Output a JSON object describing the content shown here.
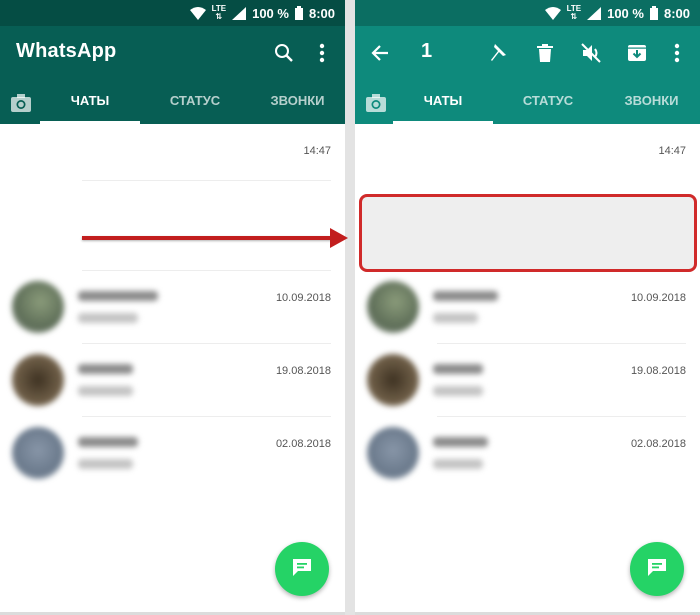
{
  "status_bar": {
    "battery": "100 %",
    "time": "8:00",
    "network": "LTE"
  },
  "left_phone": {
    "app_title": "WhatsApp",
    "tabs": [
      "ЧАТЫ",
      "СТАТУС",
      "ЗВОНКИ"
    ],
    "chats": [
      {
        "time": "14:47"
      },
      {
        "time": "10.09.2018"
      },
      {
        "time": "19.08.2018"
      },
      {
        "time": "02.08.2018"
      }
    ]
  },
  "right_phone": {
    "selected_count": "1",
    "tabs": [
      "ЧАТЫ",
      "СТАТУС",
      "ЗВОНКИ"
    ],
    "chats": [
      {
        "time": "14:47"
      },
      {
        "time": "10.09.2018"
      },
      {
        "time": "19.08.2018"
      },
      {
        "time": "02.08.2018"
      }
    ]
  },
  "icons": {
    "left_toolbar": [
      "search-icon",
      "more-vert-icon"
    ],
    "right_toolbar": [
      "back-arrow-icon",
      "pin-icon",
      "delete-icon",
      "mute-icon",
      "archive-icon",
      "more-vert-icon"
    ],
    "fab": "new-chat-icon",
    "camera_tab": "camera-icon"
  },
  "colors": {
    "header_dark": "#075e54",
    "header_selection": "#0e8a7c",
    "fab": "#25d366",
    "highlight_border": "#d02a2a"
  }
}
